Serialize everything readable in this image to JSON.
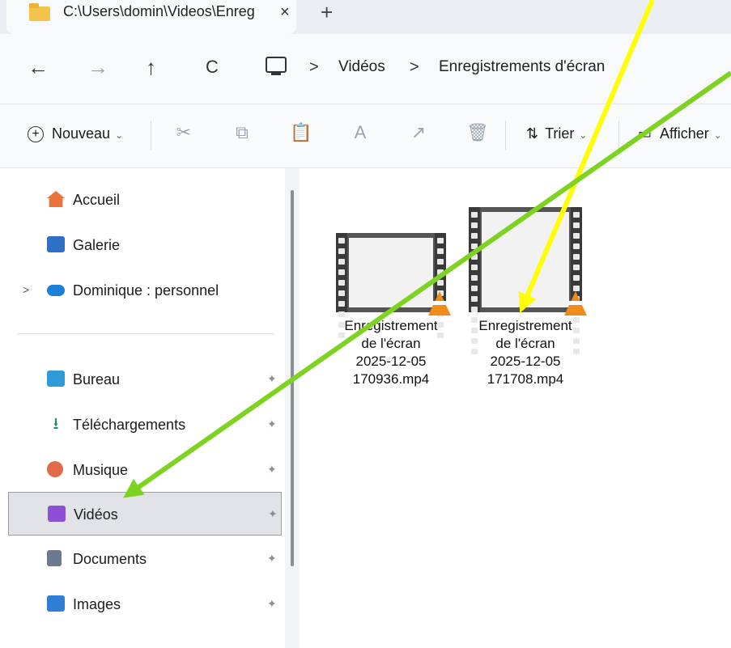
{
  "window": {
    "tab_title": "C:\\Users\\domin\\Videos\\Enreg",
    "tab_close": "×",
    "new_tab": "+"
  },
  "nav": {
    "back": "←",
    "forward": "→",
    "up": "↑",
    "refresh": "C",
    "sep1": ">",
    "crumb1": "Vidéos",
    "sep2": ">",
    "crumb2": "Enregistrements d'écran"
  },
  "toolbar": {
    "new_label": "Nouveau",
    "sort_label": "Trier",
    "view_label": "Afficher",
    "dropdown": "⌄"
  },
  "sidebar": {
    "items": [
      {
        "label": "Accueil",
        "icon": "home-icon",
        "color": "#e8743b"
      },
      {
        "label": "Galerie",
        "icon": "gallery-icon",
        "color": "#2f6fc4"
      },
      {
        "label": "Dominique : personnel",
        "icon": "onedrive-icon",
        "color": "#1e7fd8"
      },
      {
        "label": "Bureau",
        "icon": "desktop-icon",
        "color": "#2e9ad8"
      },
      {
        "label": "Téléchargements",
        "icon": "download-icon",
        "color": "#1f8f5a"
      },
      {
        "label": "Musique",
        "icon": "music-icon",
        "color": "#e06a4a"
      },
      {
        "label": "Vidéos",
        "icon": "videos-icon",
        "color": "#8c4fd6"
      },
      {
        "label": "Documents",
        "icon": "documents-icon",
        "color": "#6b7a8f"
      },
      {
        "label": "Images",
        "icon": "images-icon",
        "color": "#2f7fd4"
      }
    ],
    "pin": "📌",
    "expand": ">"
  },
  "files": [
    {
      "line1": "Enregistrement",
      "line2": "de l'écran",
      "line3": "2025-12-05",
      "line4": "170936.mp4"
    },
    {
      "line1": "Enregistrement",
      "line2": "de l'écran",
      "line3": "2025-12-05",
      "line4": "171708.mp4"
    }
  ],
  "colors": {
    "arrow_yellow": "#ffff00",
    "arrow_green": "#7ed321",
    "selected_bg": "#e1e3e6"
  }
}
